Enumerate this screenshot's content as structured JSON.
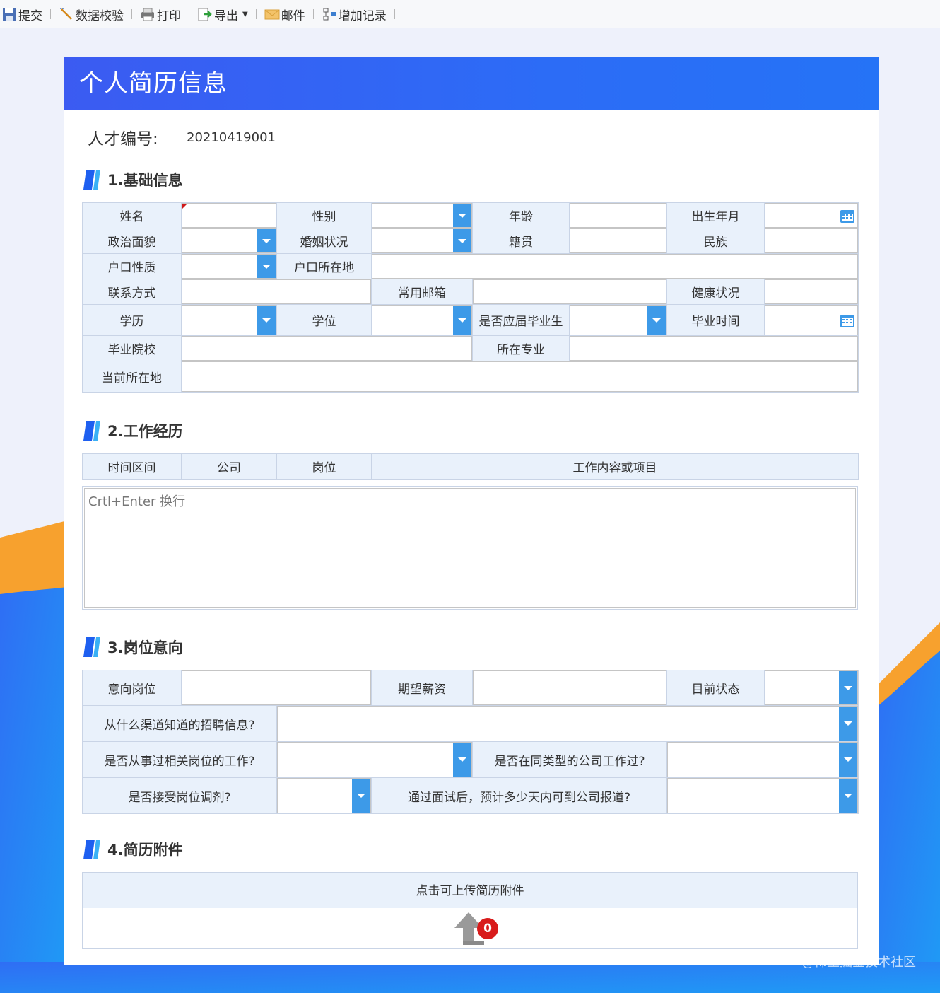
{
  "toolbar": {
    "items": [
      {
        "label": "提交",
        "icon": "save-icon"
      },
      {
        "label": "数据校验",
        "icon": "wand-icon"
      },
      {
        "label": "打印",
        "icon": "printer-icon"
      },
      {
        "label": "导出",
        "icon": "export-icon"
      },
      {
        "label": "邮件",
        "icon": "mail-icon"
      },
      {
        "label": "增加记录",
        "icon": "add-record-icon"
      }
    ]
  },
  "header": {
    "title": "个人简历信息"
  },
  "talent": {
    "label": "人才编号:",
    "value": "20210419001"
  },
  "sections": {
    "basic": "1.基础信息",
    "work": "2.工作经历",
    "intent": "3.岗位意向",
    "attach": "4.简历附件"
  },
  "basic": {
    "name": "姓名",
    "gender": "性别",
    "age": "年龄",
    "birth": "出生年月",
    "political": "政治面貌",
    "marital": "婚姻状况",
    "native": "籍贯",
    "ethnic": "民族",
    "hukou_type": "户口性质",
    "hukou_place": "户口所在地",
    "contact": "联系方式",
    "email": "常用邮箱",
    "health": "健康状况",
    "education": "学历",
    "degree": "学位",
    "fresh_grad": "是否应届毕业生",
    "grad_time": "毕业时间",
    "school": "毕业院校",
    "major": "所在专业",
    "location": "当前所在地"
  },
  "work": {
    "headers": [
      "时间区间",
      "公司",
      "岗位",
      "工作内容或项目"
    ],
    "placeholder": "Crtl+Enter 换行"
  },
  "intent": {
    "position": "意向岗位",
    "salary": "期望薪资",
    "status": "目前状态",
    "channel": "从什么渠道知道的招聘信息?",
    "related": "是否从事过相关岗位的工作?",
    "same_type": "是否在同类型的公司工作过?",
    "adjust": "是否接受岗位调剂?",
    "report_days": "通过面试后，预计多少天内可到公司报道?"
  },
  "attach": {
    "label": "点击可上传简历附件",
    "count": "0"
  },
  "watermark": "@稀土掘金技术社区",
  "colors": {
    "header": "#3b5bf2",
    "label_bg": "#e9f1fb",
    "dropdown": "#3d9ae8",
    "badge": "#d81b1b",
    "wave_orange": "#f7a12e",
    "wave_blue": "#2f7cf2"
  }
}
